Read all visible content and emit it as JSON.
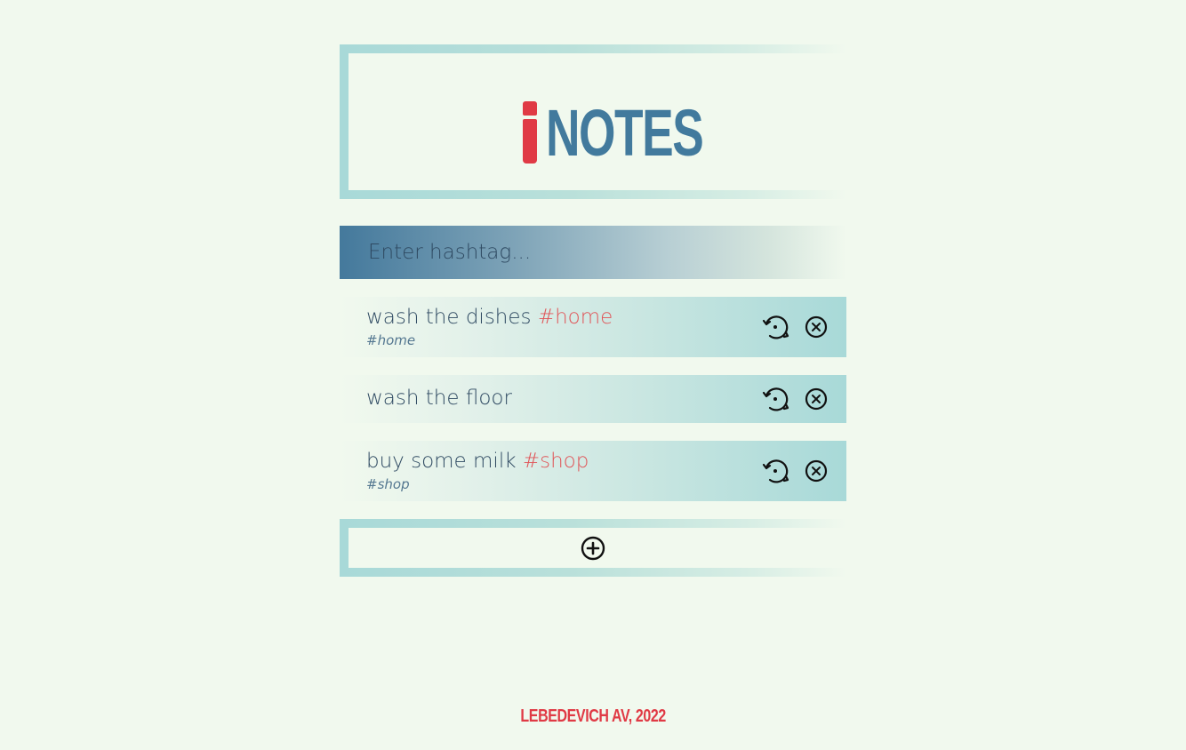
{
  "app": {
    "logo_letter": "i",
    "logo_text": "NOTES",
    "colors": {
      "background": "#f1f9ee",
      "brand_red": "#e03a45",
      "brand_blue": "#427a9d",
      "accent_teal": "#a8d9d8",
      "tag_color": "#e05558"
    }
  },
  "search": {
    "placeholder": "Enter hashtag..."
  },
  "notes": [
    {
      "text": "wash the dishes ",
      "tag": "#home",
      "sub": "#home"
    },
    {
      "text": "wash the floor",
      "tag": "",
      "sub": ""
    },
    {
      "text": "buy some milk ",
      "tag": "#shop",
      "sub": "#shop"
    }
  ],
  "icons": {
    "edit": "refresh-edit-icon",
    "delete": "close-circle-icon",
    "add": "plus-circle-icon"
  },
  "footer": {
    "text": "LEBEDEVICH AV, 2022"
  }
}
